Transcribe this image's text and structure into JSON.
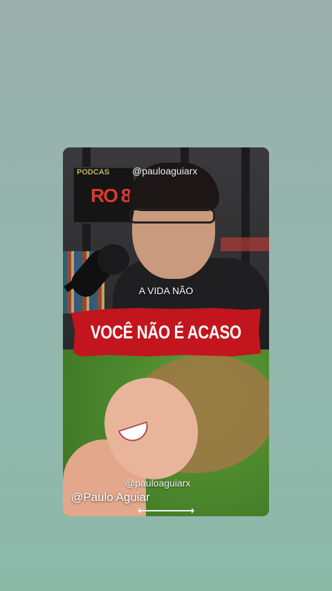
{
  "story": {
    "watermark_top": "@pauloaguiarx",
    "caption_small": "A VIDA NÃO",
    "title_banner": "VOCÊ NÃO É ACASO",
    "watermark_mid": "@pauloaguiarx",
    "author_handle": "@Paulo Aguiar",
    "sign_text": "PODCAS",
    "sign_big": "RO 8",
    "banner_color": "#c3151d",
    "background_color": "#94b6ae"
  }
}
